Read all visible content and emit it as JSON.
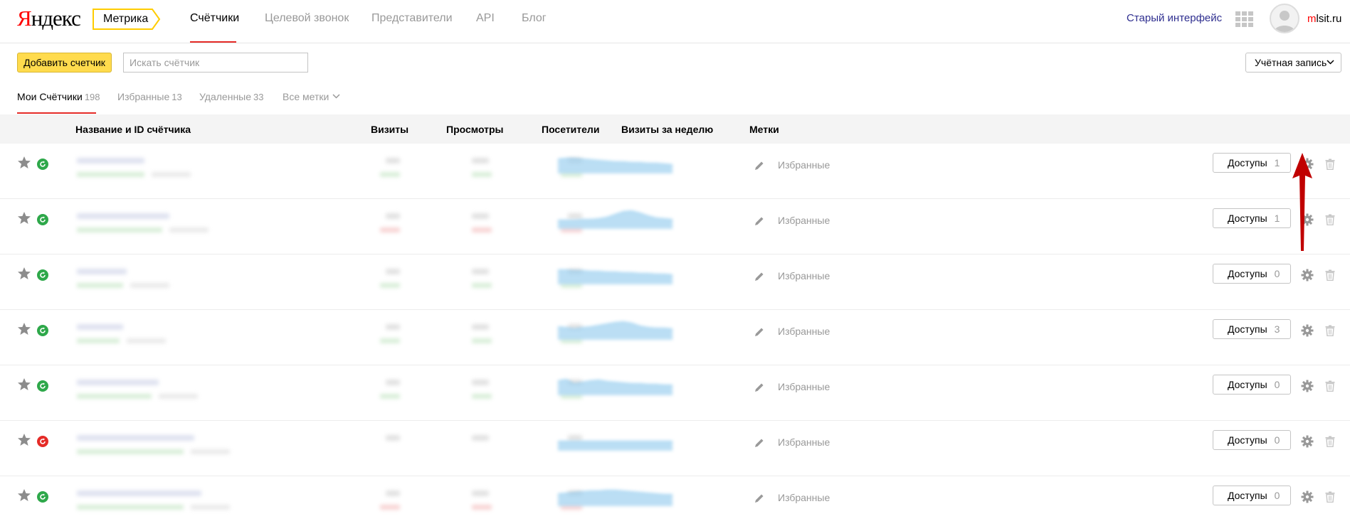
{
  "header": {
    "logo_first": "Я",
    "logo_rest": "ндекс",
    "product": "Метрика",
    "nav": [
      "Счётчики",
      "Целевой звонок",
      "Представители",
      "API",
      "Блог"
    ],
    "old_interface": "Старый интерфейс",
    "user_first": "m",
    "user_rest": "lsit.ru"
  },
  "toolbar": {
    "add_button": "Добавить счетчик",
    "search_placeholder": "Искать счётчик",
    "account": "Учётная запись"
  },
  "tabs": [
    {
      "label": "Мои Счётчики",
      "count": "198"
    },
    {
      "label": "Избранные",
      "count": "13"
    },
    {
      "label": "Удаленные",
      "count": "33"
    },
    {
      "label": "Все метки",
      "count": ""
    }
  ],
  "table": {
    "columns": [
      "Название и ID счётчика",
      "Визиты",
      "Просмотры",
      "Посетители",
      "Визиты за неделю",
      "Метки"
    ],
    "rows": [
      {
        "status": "ok",
        "label": "Избранные",
        "access_label": "Доступы",
        "access_count": "1"
      },
      {
        "status": "ok",
        "label": "Избранные",
        "access_label": "Доступы",
        "access_count": "1"
      },
      {
        "status": "ok",
        "label": "Избранные",
        "access_label": "Доступы",
        "access_count": "0"
      },
      {
        "status": "ok",
        "label": "Избранные",
        "access_label": "Доступы",
        "access_count": "3"
      },
      {
        "status": "ok",
        "label": "Избранные",
        "access_label": "Доступы",
        "access_count": "0"
      },
      {
        "status": "error",
        "label": "Избранные",
        "access_label": "Доступы",
        "access_count": "0"
      },
      {
        "status": "ok",
        "label": "Избранные",
        "access_label": "Доступы",
        "access_count": "0"
      }
    ]
  },
  "colors": {
    "accent_red": "#e52b27",
    "button_yellow": "#ffdb4d",
    "status_ok": "#2ea84a",
    "status_error": "#e52b27",
    "annotation_arrow": "#c00000"
  },
  "icons": [
    "star-icon",
    "status-icon",
    "pencil-icon",
    "gear-icon",
    "trash-icon",
    "apps-grid-icon",
    "chevron-down-icon"
  ]
}
